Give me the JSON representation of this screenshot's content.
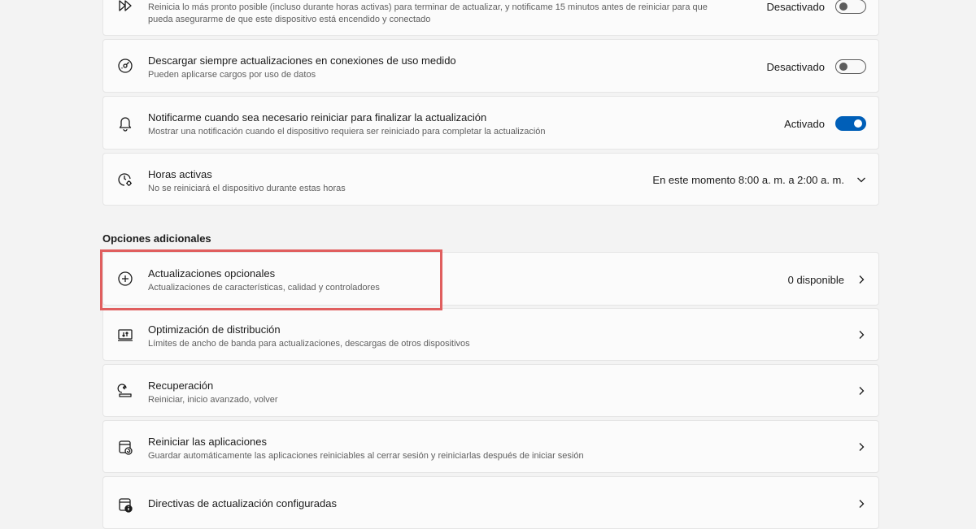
{
  "settings": {
    "restart_asap": {
      "desc_line1": "Reinicia lo más pronto posible (incluso durante horas activas) para terminar de actualizar, y notificame 15 minutos antes de reiniciar para que",
      "desc_line2": "pueda asegurarme de que este dispositivo está encendido y conectado",
      "status": "Desactivado",
      "toggle_on": false
    },
    "metered": {
      "title": "Descargar siempre actualizaciones en conexiones de uso medido",
      "desc": "Pueden aplicarse cargos por uso de datos",
      "status": "Desactivado",
      "toggle_on": false
    },
    "notify_restart": {
      "title": "Notificarme cuando sea necesario reiniciar para finalizar la actualización",
      "desc": "Mostrar una notificación cuando el dispositivo requiera ser reiniciado para completar la actualización",
      "status": "Activado",
      "toggle_on": true
    },
    "active_hours": {
      "title": "Horas activas",
      "desc": "No se reiniciará el dispositivo durante estas horas",
      "value": "En este momento 8:00 a. m. a 2:00 a. m."
    }
  },
  "additional": {
    "header": "Opciones adicionales",
    "items": [
      {
        "title": "Actualizaciones opcionales",
        "desc": "Actualizaciones de características, calidad y controladores",
        "value": "0 disponible",
        "icon": "plus-circle-icon"
      },
      {
        "title": "Optimización de distribución",
        "desc": "Límites de ancho de banda para actualizaciones, descargas de otros dispositivos",
        "icon": "delivery-optimization-icon"
      },
      {
        "title": "Recuperación",
        "desc": "Reiniciar, inicio avanzado, volver",
        "icon": "recovery-icon"
      },
      {
        "title": "Reiniciar las aplicaciones",
        "desc": "Guardar automáticamente las aplicaciones reiniciables al cerrar sesión y reiniciarlas después de iniciar sesión",
        "icon": "restart-apps-icon"
      },
      {
        "title": "Directivas de actualización configuradas",
        "icon": "policy-info-icon"
      }
    ]
  },
  "colors": {
    "accent": "#005fb8",
    "highlight": "#e05e5e"
  }
}
